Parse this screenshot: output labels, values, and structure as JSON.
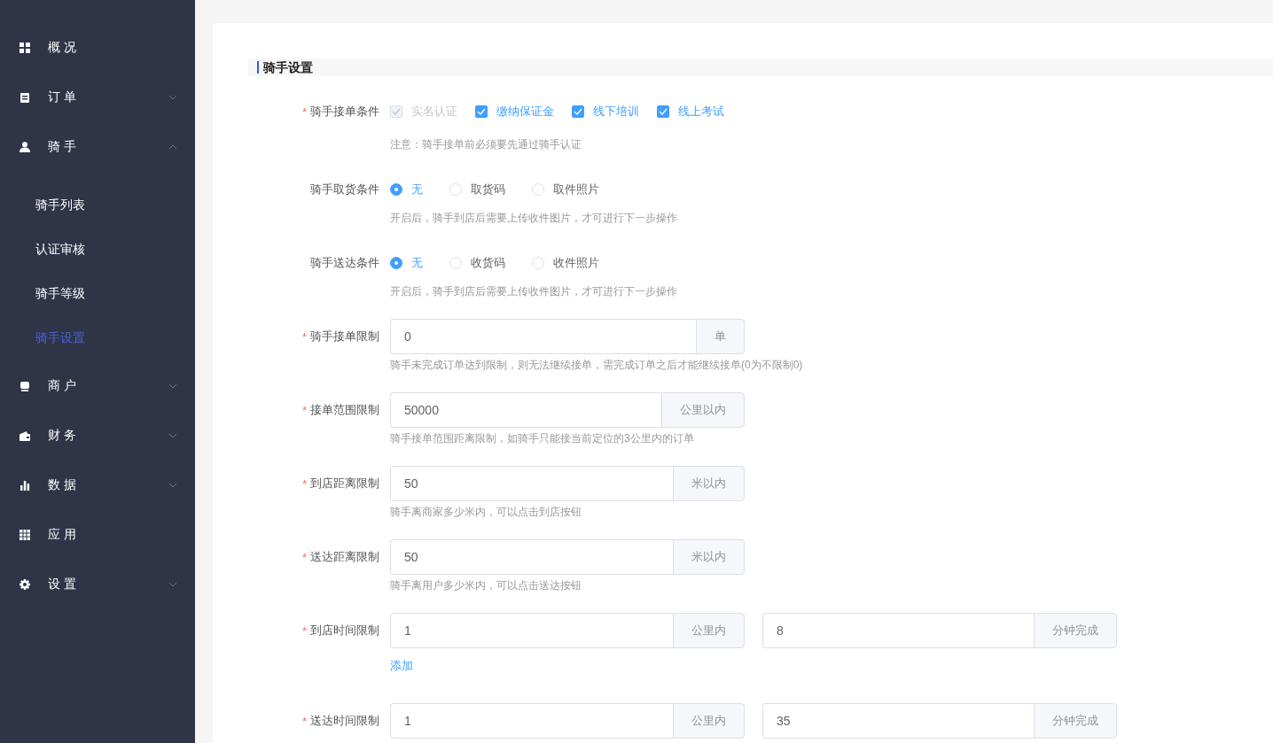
{
  "sidebar": {
    "items": [
      {
        "label": "概况"
      },
      {
        "label": "订单",
        "expanded": false
      },
      {
        "label": "骑手",
        "expanded": true,
        "children": [
          {
            "label": "骑手列表",
            "selected": false
          },
          {
            "label": "认证审核",
            "selected": false
          },
          {
            "label": "骑手等级",
            "selected": false
          },
          {
            "label": "骑手设置",
            "selected": true
          }
        ]
      },
      {
        "label": "商户",
        "expanded": false
      },
      {
        "label": "财务",
        "expanded": false
      },
      {
        "label": "数据",
        "expanded": false
      },
      {
        "label": "应用"
      },
      {
        "label": "设置",
        "expanded": false
      }
    ]
  },
  "form": {
    "title": "骑手设置",
    "rows": [
      {
        "kind": "checkboxes",
        "label": "骑手接单条件",
        "mark": "*",
        "options": [
          {
            "label": "实名认证",
            "checked": true,
            "disabled": true
          },
          {
            "label": "缴纳保证金",
            "checked": true,
            "disabled": false
          },
          {
            "label": "线下培训",
            "checked": true,
            "disabled": false
          },
          {
            "label": "线上考试",
            "checked": true,
            "disabled": false
          }
        ],
        "note": "注意：骑手接单前必须要先通过骑手认证"
      },
      {
        "kind": "radios",
        "label": "骑手取货条件",
        "options": [
          {
            "label": "无",
            "selected": true
          },
          {
            "label": "取货码",
            "selected": false
          },
          {
            "label": "取件照片",
            "selected": false
          }
        ],
        "note": "开启后，骑手到店后需要上传收件图片，才可进行下一步操作"
      },
      {
        "kind": "radios",
        "label": "骑手送达条件",
        "options": [
          {
            "label": "无",
            "selected": true
          },
          {
            "label": "收货码",
            "selected": false
          },
          {
            "label": "收件照片",
            "selected": false
          }
        ],
        "note": "开启后，骑手到店后需要上传收件图片，才可进行下一步操作"
      },
      {
        "kind": "input",
        "label": "骑手接单限制",
        "mark": "*",
        "inputs": [
          {
            "value": "0",
            "append": "单"
          }
        ],
        "note": "骑手未完成订单达到限制，则无法继续接单，需完成订单之后才能继续接单(0为不限制0)"
      },
      {
        "kind": "input",
        "label": "接单范围限制",
        "mark": "*",
        "inputs": [
          {
            "value": "50000",
            "append": "公里以内"
          }
        ],
        "note": "骑手接单范围距离限制，如骑手只能接当前定位的3公里内的订单"
      },
      {
        "kind": "input",
        "label": "到店距离限制",
        "mark": "*",
        "inputs": [
          {
            "value": "50",
            "append": "米以内"
          }
        ],
        "note": "骑手离商家多少米内，可以点击到店按钮"
      },
      {
        "kind": "input",
        "label": "送达距离限制",
        "mark": "*",
        "inputs": [
          {
            "value": "50",
            "append": "米以内"
          }
        ],
        "note": "骑手离用户多少米内，可以点击送达按钮"
      },
      {
        "kind": "input",
        "label": "到店时间限制",
        "mark": "*",
        "inputs": [
          {
            "value": "1",
            "append": "公里内"
          },
          {
            "value": "8",
            "append": "分钟完成"
          }
        ],
        "link": "添加"
      },
      {
        "kind": "input",
        "label": "送达时间限制",
        "mark": "*",
        "inputs": [
          {
            "value": "1",
            "append": "公里内"
          },
          {
            "value": "35",
            "append": "分钟完成"
          }
        ]
      }
    ]
  }
}
